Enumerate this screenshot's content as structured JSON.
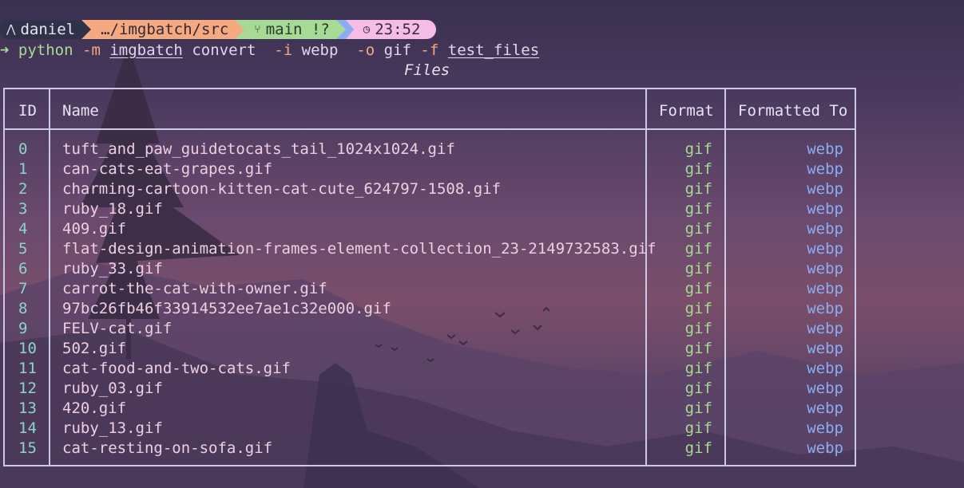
{
  "prompt": {
    "user": "daniel",
    "path": "…/imgbatch/src",
    "branch": "main !?",
    "time": "23:52"
  },
  "command": {
    "arrow": "➜",
    "bin": "python",
    "flag_m": "-m",
    "module": "imgbatch",
    "sub": "convert",
    "flag_i": "-i",
    "in_fmt": "webp",
    "flag_o": "-o",
    "out_fmt": "gif",
    "flag_f": "-f",
    "folder": "test_files"
  },
  "table": {
    "caption": "Files",
    "headers": {
      "id": "ID",
      "name": "Name",
      "format": "Format",
      "formatted_to": "Formatted To"
    },
    "rows": [
      {
        "id": "0",
        "name": "tuft_and_paw_guidetocats_tail_1024x1024.gif",
        "format": "gif",
        "to": "webp"
      },
      {
        "id": "1",
        "name": "can-cats-eat-grapes.gif",
        "format": "gif",
        "to": "webp"
      },
      {
        "id": "2",
        "name": "charming-cartoon-kitten-cat-cute_624797-1508.gif",
        "format": "gif",
        "to": "webp"
      },
      {
        "id": "3",
        "name": "ruby_18.gif",
        "format": "gif",
        "to": "webp"
      },
      {
        "id": "4",
        "name": "409.gif",
        "format": "gif",
        "to": "webp"
      },
      {
        "id": "5",
        "name": "flat-design-animation-frames-element-collection_23-2149732583.gif",
        "format": "gif",
        "to": "webp"
      },
      {
        "id": "6",
        "name": "ruby_33.gif",
        "format": "gif",
        "to": "webp"
      },
      {
        "id": "7",
        "name": "carrot-the-cat-with-owner.gif",
        "format": "gif",
        "to": "webp"
      },
      {
        "id": "8",
        "name": "97bc26fb46f33914532ee7ae1c32e000.gif",
        "format": "gif",
        "to": "webp"
      },
      {
        "id": "9",
        "name": "FELV-cat.gif",
        "format": "gif",
        "to": "webp"
      },
      {
        "id": "10",
        "name": "502.gif",
        "format": "gif",
        "to": "webp"
      },
      {
        "id": "11",
        "name": "cat-food-and-two-cats.gif",
        "format": "gif",
        "to": "webp"
      },
      {
        "id": "12",
        "name": "ruby_03.gif",
        "format": "gif",
        "to": "webp"
      },
      {
        "id": "13",
        "name": "420.gif",
        "format": "gif",
        "to": "webp"
      },
      {
        "id": "14",
        "name": "ruby_13.gif",
        "format": "gif",
        "to": "webp"
      },
      {
        "id": "15",
        "name": "cat-resting-on-sofa.gif",
        "format": "gif",
        "to": "webp"
      }
    ]
  }
}
